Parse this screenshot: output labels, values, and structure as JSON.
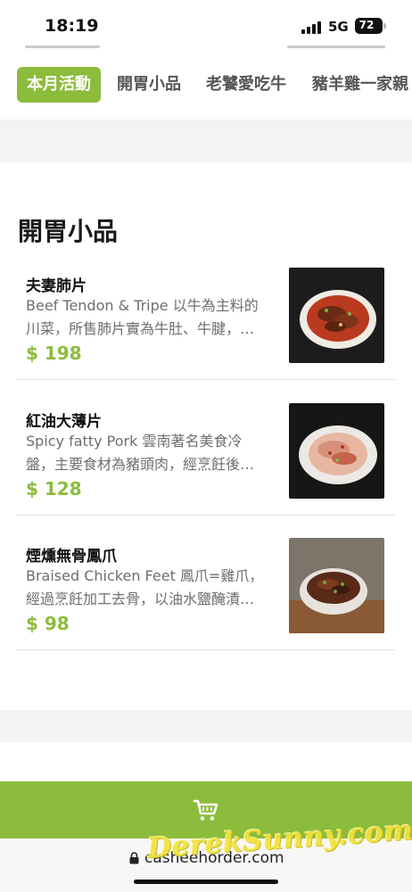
{
  "status_bar": {
    "time": "18:19",
    "network": "5G",
    "battery": "72"
  },
  "tabs": [
    {
      "label": "本月活動",
      "active": true
    },
    {
      "label": "開胃小品",
      "active": false
    },
    {
      "label": "老饕愛吃牛",
      "active": false
    },
    {
      "label": "豬羊雞一家親",
      "active": false
    }
  ],
  "section": {
    "title": "開胃小品"
  },
  "menu_items": [
    {
      "name": "夫妻肺片",
      "desc_line1": "Beef Tendon & Tripe 以牛為主料的",
      "desc_line2": "川菜，所售肺片實為牛肚、牛腱，…",
      "price": "$ 198"
    },
    {
      "name": "紅油大薄片",
      "desc_line1": "Spicy fatty Pork 雲南著名美食冷",
      "desc_line2": "盤，主要食材為豬頭肉，經烹飪後…",
      "price": "$ 128"
    },
    {
      "name": "煙燻無骨鳳爪",
      "desc_line1": "Braised Chicken Feet 鳳爪=雞爪，",
      "desc_line2": "經過烹飪加工去骨，以油水鹽醃漬…",
      "price": "$ 98"
    }
  ],
  "cart": {
    "icon": "cart-icon"
  },
  "browser": {
    "url": "casheehorder.com"
  },
  "watermark": "DerekSunny.com",
  "colors": {
    "accent": "#8cbc3c",
    "band": "#f3f3f3"
  }
}
